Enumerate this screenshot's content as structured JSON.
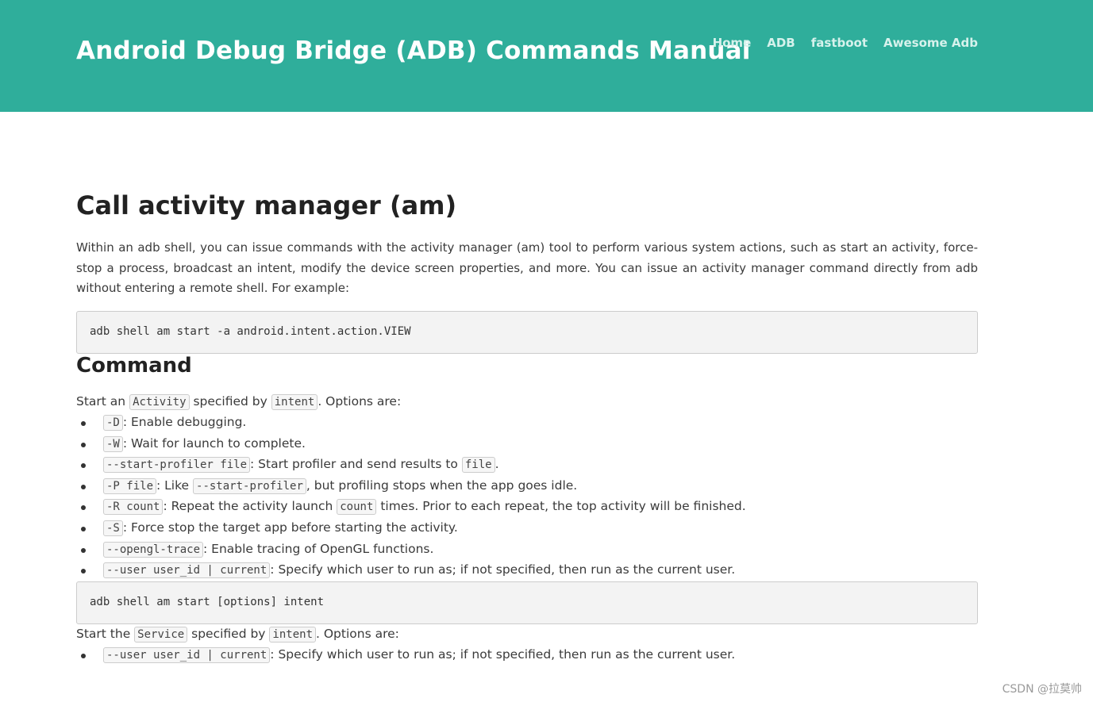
{
  "header": {
    "title": "Android Debug Bridge (ADB) Commands Manual",
    "nav": [
      "Home",
      "ADB",
      "fastboot",
      "Awesome Adb"
    ]
  },
  "main": {
    "heading": "Call activity manager (am)",
    "intro": "Within an adb shell, you can issue commands with the activity manager (am) tool to perform various system actions, such as start an activity, force-stop a process, broadcast an intent, modify the device screen properties, and more. You can issue an activity manager command directly from adb without entering a remote shell. For example:",
    "example_code": "adb shell am start -a android.intent.action.VIEW",
    "command_heading": "Command",
    "start_activity": {
      "prefix": "Start an",
      "code1": "Activity",
      "mid": "specified by",
      "code2": "intent",
      "suffix": ". Options are:"
    },
    "options": [
      {
        "code": "-D",
        "text": ": Enable debugging."
      },
      {
        "code": "-W",
        "text": ": Wait for launch to complete."
      },
      {
        "code": "--start-profiler file",
        "text": ": Start profiler and send results to",
        "code2": "file",
        "text2": "."
      },
      {
        "code": "-P file",
        "text": ": Like",
        "code2": "--start-profiler",
        "text2": ", but profiling stops when the app goes idle."
      },
      {
        "code": "-R count",
        "text": ": Repeat the activity launch",
        "code2": "count",
        "text2": "times. Prior to each repeat, the top activity will be finished."
      },
      {
        "code": "-S",
        "text": ": Force stop the target app before starting the activity."
      },
      {
        "code": "--opengl-trace",
        "text": ": Enable tracing of OpenGL functions."
      },
      {
        "code": "--user user_id | current",
        "text": ": Specify which user to run as; if not specified, then run as the current user."
      }
    ],
    "start_code": "adb shell am start [options] intent",
    "start_service": {
      "prefix": "Start the",
      "code1": "Service",
      "mid": "specified by",
      "code2": "intent",
      "suffix": ". Options are:"
    },
    "service_options": [
      {
        "code": "--user user_id | current",
        "text": ": Specify which user to run as; if not specified, then run as the current user."
      }
    ]
  },
  "watermark": "CSDN @拉莫帅"
}
